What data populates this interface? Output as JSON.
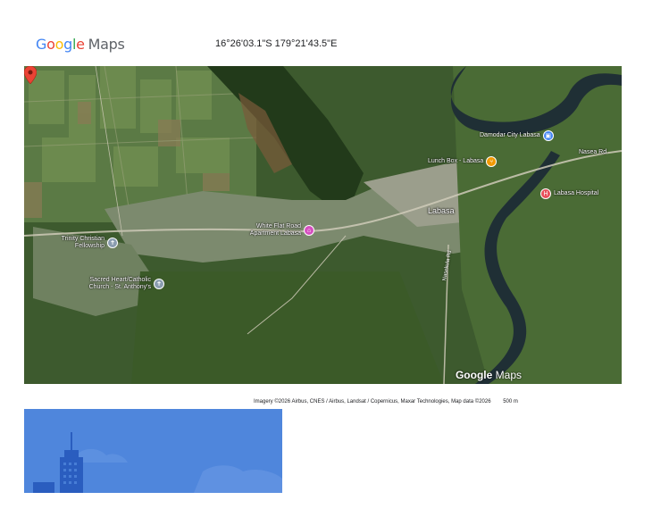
{
  "header": {
    "logo": {
      "letters": [
        "G",
        "o",
        "o",
        "g",
        "l",
        "e"
      ],
      "maps": "Maps"
    },
    "coordinates": "16°26'03.1\"S 179°21'43.5\"E"
  },
  "map": {
    "watermark_google": "Google",
    "watermark_maps": "Maps",
    "town_label": "Labasa",
    "road_label": "Nasekula Rd",
    "pois": [
      {
        "label": "Damodar City Labasa",
        "icon": "shopping-icon",
        "color": "#4285F4"
      },
      {
        "label": "Lunch Box - Labasa",
        "icon": "restaurant-icon",
        "color": "#F29900"
      },
      {
        "label": "Nasea Rd",
        "icon": "",
        "color": ""
      },
      {
        "label": "Labasa Hospital",
        "icon": "hospital-icon",
        "color": "#E8505B"
      },
      {
        "label": "White Flat Road Apartment Labasa",
        "icon": "hotel-icon",
        "color": "#D64FC0"
      },
      {
        "label": "Trinity Christian Fellowship",
        "icon": "church-icon",
        "color": "#8A9CB0"
      },
      {
        "label": "Sacred Heart/Catholic Church - St. Anthony's",
        "icon": "church-icon",
        "color": "#8A9CB0"
      }
    ],
    "marker": {
      "icon": "location-pin-icon",
      "color": "#EA4335"
    }
  },
  "attribution": {
    "text": "Imagery ©2026 Airbus, CNES / Airbus, Landsat / Copernicus, Maxar Technologies, Map data ©2026",
    "scale": "500 m"
  },
  "street_view": {
    "icon": "city-skyline-icon"
  }
}
